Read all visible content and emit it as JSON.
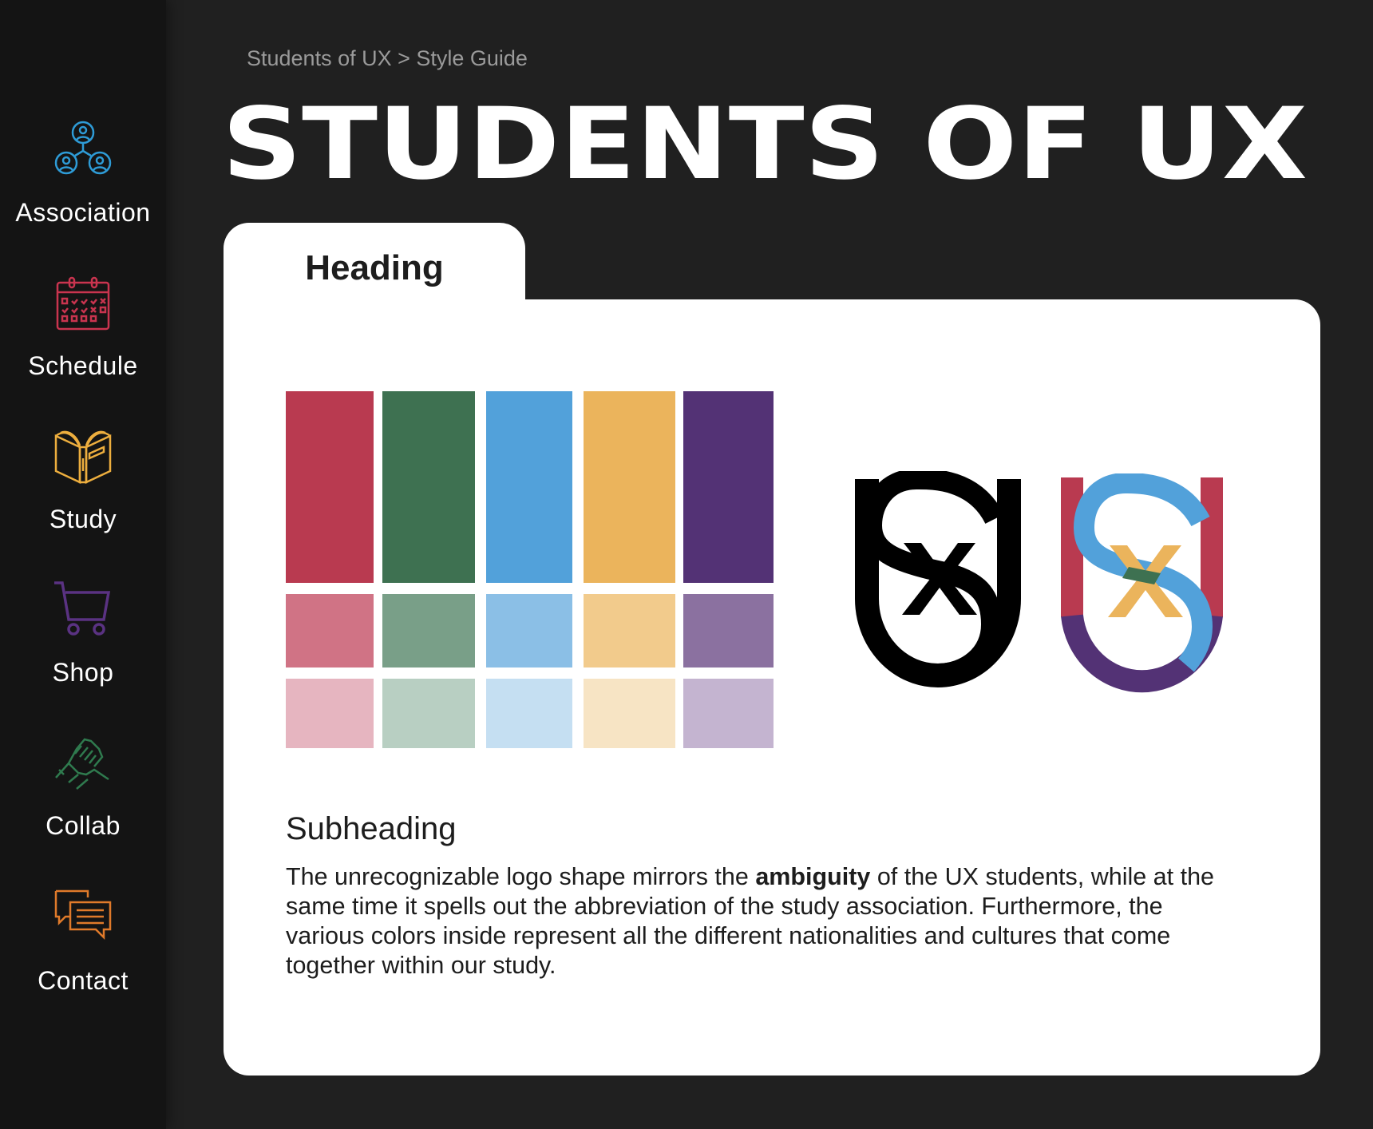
{
  "sidebar": {
    "items": [
      {
        "label": "Association",
        "icon": "association-icon",
        "color": "#2E9BD6"
      },
      {
        "label": "Schedule",
        "icon": "calendar-icon",
        "color": "#C9344F"
      },
      {
        "label": "Study",
        "icon": "book-icon",
        "color": "#EDAE3E"
      },
      {
        "label": "Shop",
        "icon": "cart-icon",
        "color": "#5A3282"
      },
      {
        "label": "Collab",
        "icon": "handshake-icon",
        "color": "#2F7A4E"
      },
      {
        "label": "Contact",
        "icon": "chat-icon",
        "color": "#E07A2A"
      }
    ]
  },
  "breadcrumb": "Students of UX > Style Guide",
  "title": "STUDENTS OF UX",
  "tab": {
    "label": "Heading"
  },
  "palette": {
    "primary": [
      "#B93A50",
      "#3E7151",
      "#52A1DA",
      "#EBB45C",
      "#533275"
    ],
    "medium": [
      "#D07385",
      "#799F88",
      "#8BBFE6",
      "#F2CB8C",
      "#8B71A0"
    ],
    "light": [
      "#E6B5C0",
      "#B8CFC2",
      "#C5DFF2",
      "#F7E4C4",
      "#C4B4D0"
    ]
  },
  "content": {
    "subheading": "Subheading",
    "body_pre": "The unrecognizable logo shape mirrors the ",
    "body_bold": "ambiguity",
    "body_post": " of the UX students, while at the same time it spells out the abbreviation of the study association. Furthermore, the various colors inside represent all the different nationalities and cultures that come together within our study."
  }
}
